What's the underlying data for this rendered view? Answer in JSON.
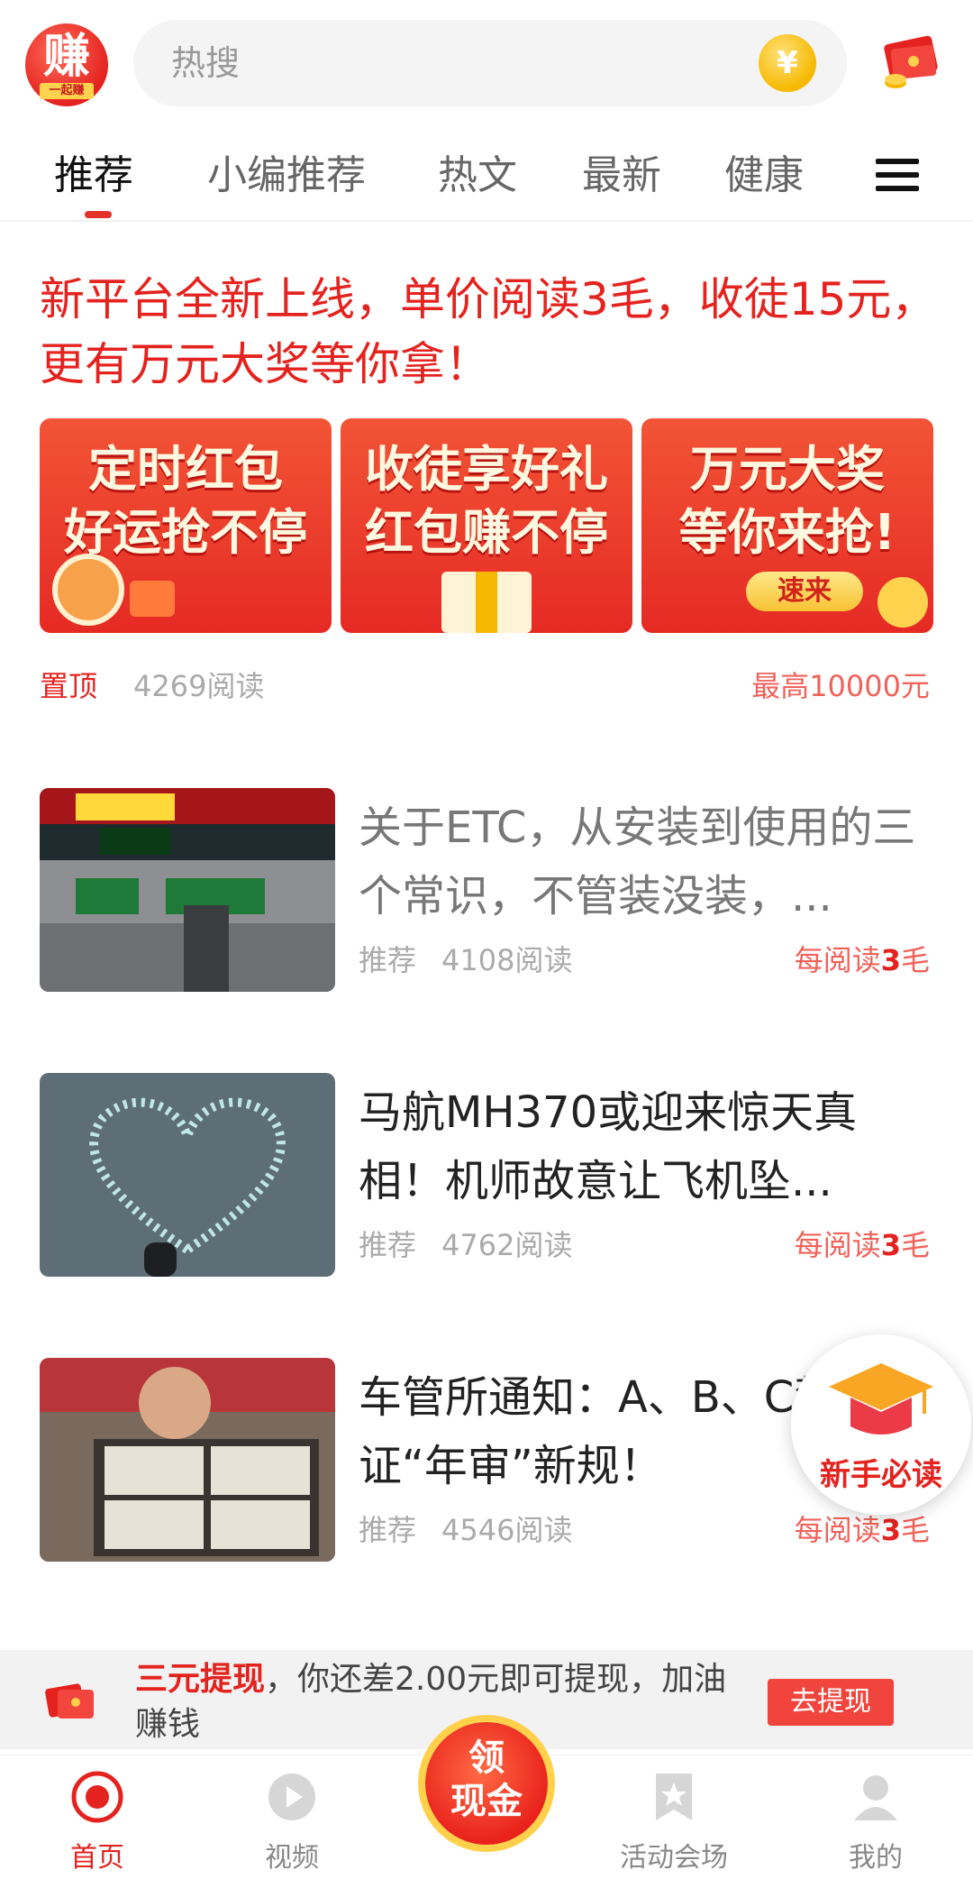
{
  "header": {
    "logo_text": "赚",
    "logo_sub": "一起赚",
    "search_placeholder": "热搜",
    "coin_symbol": "¥"
  },
  "tabs": [
    {
      "label": "推荐",
      "active": true
    },
    {
      "label": "小编推荐"
    },
    {
      "label": "热文"
    },
    {
      "label": "最新"
    },
    {
      "label": "健康"
    }
  ],
  "promo": {
    "title": "新平台全新上线，单价阅读3毛，收徒15元，更有万元大奖等你拿！",
    "banners": [
      {
        "line1": "定时红包",
        "line2": "好运抢不停"
      },
      {
        "line1": "收徒享好礼",
        "line2": "红包赚不停"
      },
      {
        "line1": "万元大奖",
        "line2": "等你来抢!",
        "cta": "速来"
      }
    ],
    "pin_label": "置顶",
    "reads": "4269阅读",
    "max_reward": "最高10000元"
  },
  "articles": [
    {
      "title": "关于ETC，从安装到使用的三个常识，不管装没装，...",
      "tag": "推荐",
      "reads": "4108阅读",
      "earn_prefix": "每阅读",
      "earn_num": "3",
      "earn_unit": "毛",
      "read_state": "read"
    },
    {
      "title": "马航MH370或迎来惊天真相！机师故意让飞机坠...",
      "tag": "推荐",
      "reads": "4762阅读",
      "earn_prefix": "每阅读",
      "earn_num": "3",
      "earn_unit": "毛",
      "read_state": "unread"
    },
    {
      "title": "车管所通知：A、B、C驾驶证“年审”新规！",
      "tag": "推荐",
      "reads": "4546阅读",
      "earn_prefix": "每阅读",
      "earn_num": "3",
      "earn_unit": "毛",
      "read_state": "unread"
    }
  ],
  "floating": {
    "newbie_label": "新手必读"
  },
  "withdraw_bar": {
    "highlight": "三元提现",
    "text": "，你还差2.00元即可提现，加油赚钱",
    "button": "去提现"
  },
  "bottom_nav": [
    {
      "label": "首页",
      "icon": "home-icon",
      "active": true
    },
    {
      "label": "视频",
      "icon": "video-play-icon"
    },
    {
      "label": "活动会场",
      "icon": "event-bookmark-icon"
    },
    {
      "label": "我的",
      "icon": "profile-icon"
    }
  ],
  "cash_button": {
    "line1": "领",
    "line2": "现金"
  },
  "colors": {
    "accent": "#e4231f",
    "earn": "#f0625a",
    "muted": "#aaaaaa"
  }
}
